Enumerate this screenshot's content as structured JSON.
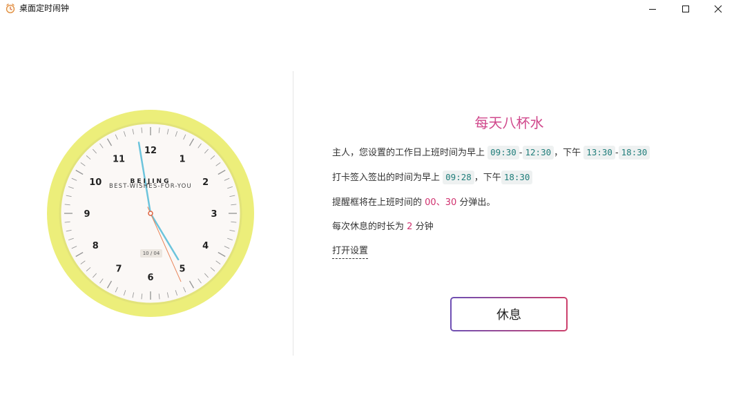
{
  "window": {
    "title": "桌面定时闹钟",
    "controls": [
      "minimize",
      "maximize",
      "close"
    ]
  },
  "clock": {
    "city": "BEIJING",
    "slogan": "BEST-WISHES-FOR-YOU",
    "date": "10 / 04",
    "numerals": [
      "12",
      "1",
      "2",
      "3",
      "4",
      "5",
      "6",
      "7",
      "8",
      "9",
      "10",
      "11"
    ],
    "time": {
      "hour": 4,
      "minute": 58,
      "second": 26
    },
    "colors": {
      "rim": "#ecee7a",
      "face": "#fbf8f6",
      "hands": "#6cc4dc",
      "second_hand": "#e8855a"
    }
  },
  "message": {
    "title": "每天八杯水",
    "line1": {
      "text1": "主人，您设置的工作日上班时间为早上",
      "am_start": "09:30",
      "sep1": "-",
      "am_end": "12:30",
      "text2": "，下午",
      "pm_start": "13:30",
      "sep2": "-",
      "pm_end": "18:30"
    },
    "line2": {
      "text1": "打卡签入签出的时间为早上",
      "checkin": "09:28",
      "text2": "，下午",
      "checkout": "18:30"
    },
    "line3": {
      "text1": "提醒框将在上班时间的",
      "min1": "00",
      "sep": "、",
      "min2": "30",
      "text2": "分弹出。"
    },
    "line4": {
      "text1": "每次休息的时长为",
      "duration": "2",
      "text2": "分钟"
    },
    "settings_link": "打开设置"
  },
  "actions": {
    "rest_button": "休息"
  },
  "colors": {
    "accent": "#d0488c",
    "highlight": "#d0306e",
    "code_text": "#1f7d7a",
    "gradient_start": "#6d4fb3",
    "gradient_end": "#cc3f6b"
  }
}
